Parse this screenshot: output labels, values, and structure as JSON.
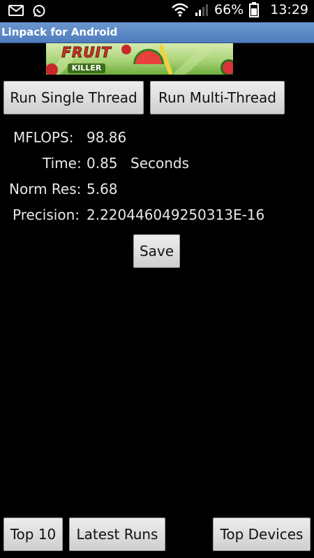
{
  "status_bar": {
    "battery_level": "66%",
    "time": "13:29",
    "icons": [
      "gmail-icon",
      "whatsapp-icon",
      "wifi-icon",
      "signal-icon",
      "battery-icon"
    ]
  },
  "app": {
    "title": "Linpack for Android"
  },
  "ad": {
    "brand_line1": "FRUIT",
    "brand_line2": "KILLER"
  },
  "toolbar": {
    "single_thread_label": "Run Single Thread",
    "multi_thread_label": "Run Multi-Thread"
  },
  "results": {
    "mflops_label": "MFLOPS:",
    "mflops_value": "98.86",
    "time_label": "Time:",
    "time_value": "0.85",
    "time_unit": "Seconds",
    "norm_res_label": "Norm Res:",
    "norm_res_value": "5.68",
    "precision_label": "Precision:",
    "precision_value": "2.220446049250313E-16"
  },
  "save_label": "Save",
  "bottom_nav": {
    "top10_label": "Top 10",
    "latest_runs_label": "Latest Runs",
    "top_devices_label": "Top Devices"
  }
}
